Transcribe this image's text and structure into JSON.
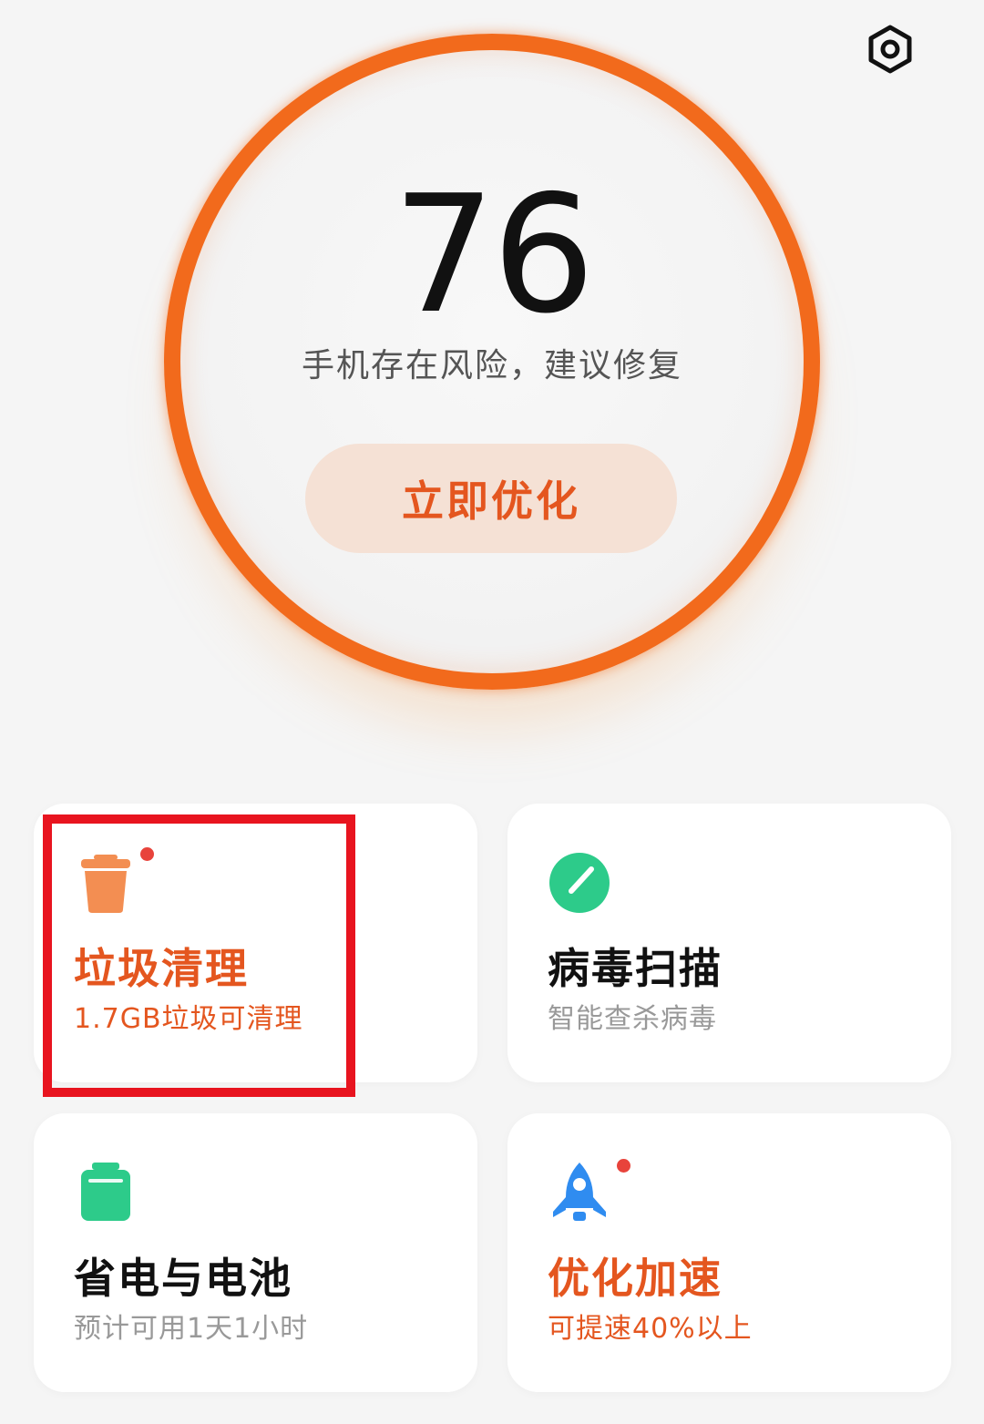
{
  "header": {
    "settings_icon": "gear-icon"
  },
  "score": {
    "value": "76",
    "description": "手机存在风险，建议修复",
    "action_label": "立即优化",
    "ring_color": "#f26a1c"
  },
  "cards": [
    {
      "title": "垃圾清理",
      "subtitle": "1.7GB垃圾可清理",
      "icon": "trash-icon",
      "icon_color": "#f38e52",
      "has_dot": true,
      "alert": true
    },
    {
      "title": "病毒扫描",
      "subtitle": "智能查杀病毒",
      "icon": "shield-scan-icon",
      "icon_color": "#2dcb8a",
      "has_dot": false,
      "alert": false
    },
    {
      "title": "省电与电池",
      "subtitle": "预计可用1天1小时",
      "icon": "battery-icon",
      "icon_color": "#2dcb8a",
      "has_dot": false,
      "alert": false
    },
    {
      "title": "优化加速",
      "subtitle": "可提速40%以上",
      "icon": "rocket-icon",
      "icon_color": "#2f8cf0",
      "has_dot": true,
      "alert": true
    }
  ],
  "colors": {
    "accent": "#e4561f",
    "dot": "#e8433b",
    "highlight": "#e8141f"
  }
}
